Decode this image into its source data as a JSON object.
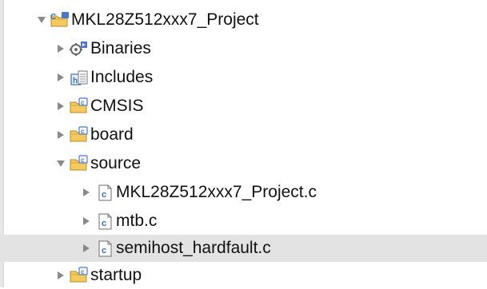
{
  "explorer": {
    "project": {
      "label": "MKL28Z512xxx7_Project",
      "icon": "c-project-folder-icon",
      "expanded": true
    },
    "items": [
      {
        "label": "Binaries",
        "icon": "binaries-icon",
        "expanded": false
      },
      {
        "label": "Includes",
        "icon": "includes-icon",
        "expanded": false
      },
      {
        "label": "CMSIS",
        "icon": "source-folder-icon",
        "expanded": false
      },
      {
        "label": "board",
        "icon": "source-folder-icon",
        "expanded": false
      },
      {
        "label": "source",
        "icon": "source-folder-icon",
        "expanded": true
      },
      {
        "label": "startup",
        "icon": "source-folder-icon",
        "expanded": false
      }
    ],
    "source_files": [
      {
        "label": "MKL28Z512xxx7_Project.c",
        "icon": "c-file-icon",
        "selected": false
      },
      {
        "label": "mtb.c",
        "icon": "c-file-icon",
        "selected": false
      },
      {
        "label": "semihost_hardfault.c",
        "icon": "c-file-icon",
        "selected": true
      }
    ],
    "selection_color": "#e3e3e3",
    "folder_color": "#f2c14e"
  }
}
